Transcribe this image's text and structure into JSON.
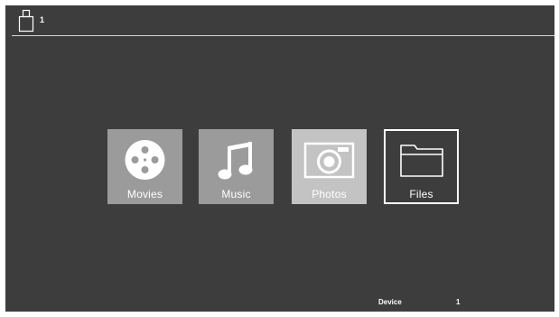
{
  "header": {
    "usb_icon": "usb-drive-icon",
    "device_count": "1"
  },
  "menu": {
    "items": [
      {
        "label": "Movies",
        "icon": "film-reel-icon",
        "state": "normal"
      },
      {
        "label": "Music",
        "icon": "music-note-icon",
        "state": "normal"
      },
      {
        "label": "Photos",
        "icon": "camera-icon",
        "state": "dimmed"
      },
      {
        "label": "Files",
        "icon": "folder-icon",
        "state": "selected"
      }
    ]
  },
  "status": {
    "label": "Device",
    "value": "1"
  },
  "colors": {
    "background": "#3d3d3d",
    "tile": "#9b9b9b",
    "tile_dimmed": "#c3c3c3",
    "selection_border": "#ffffff",
    "text": "#ffffff"
  }
}
